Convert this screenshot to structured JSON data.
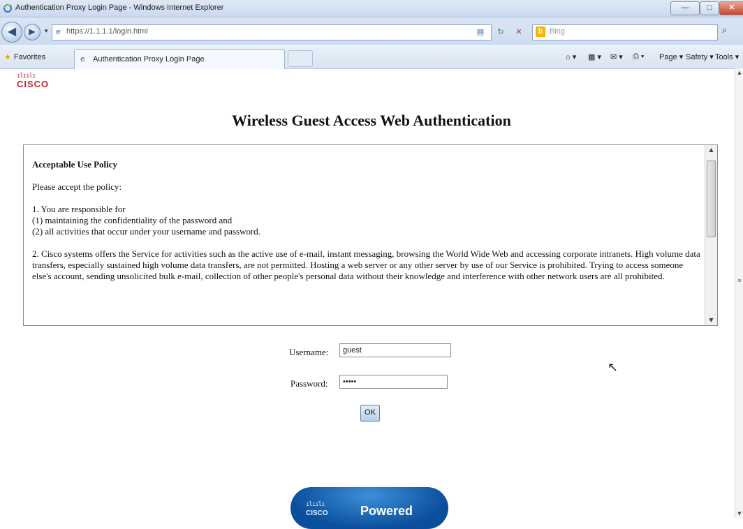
{
  "window": {
    "title": "Authentication Proxy Login Page - Windows Internet Explorer",
    "buttons": {
      "minimize": "—",
      "maximize": "□",
      "close": "✕"
    }
  },
  "addressbar": {
    "url": "https://1.1.1.1/login.html",
    "search_placeholder": "Bing"
  },
  "favbar": {
    "favorites_label": "Favorites",
    "tab_label": "Authentication Proxy Login Page",
    "commands": [
      "Page ▾",
      "Safety ▾",
      "Tools ▾"
    ]
  },
  "page": {
    "logo_text": "CISCO",
    "title": "Wireless Guest Access Web Authentication",
    "policy": {
      "heading": "Acceptable Use Policy",
      "intro": "Please accept the policy:",
      "item1_title": "1. You are responsible for",
      "item1_a": "(1) maintaining the confidentiality of the password and",
      "item1_b": "(2) all activities that occur under your username and password.",
      "item2": "2. Cisco systems offers the Service for activities such as the active use of e-mail, instant messaging, browsing the World Wide Web and accessing corporate intranets. High volume data transfers, especially sustained high volume data transfers, are not permitted. Hosting a web server or any other server by use of our Service is prohibited. Trying to access someone else's account, sending unsolicited bulk e-mail, collection of other people's personal data without their knowledge and interference with other network users are all prohibited."
    },
    "form": {
      "username_label": "Username:",
      "username_value": "guest",
      "password_label": "Password:",
      "password_value": "•••••",
      "ok_label": "OK"
    },
    "powered_badge": {
      "logo": "CISCO",
      "text": "Powered"
    }
  }
}
